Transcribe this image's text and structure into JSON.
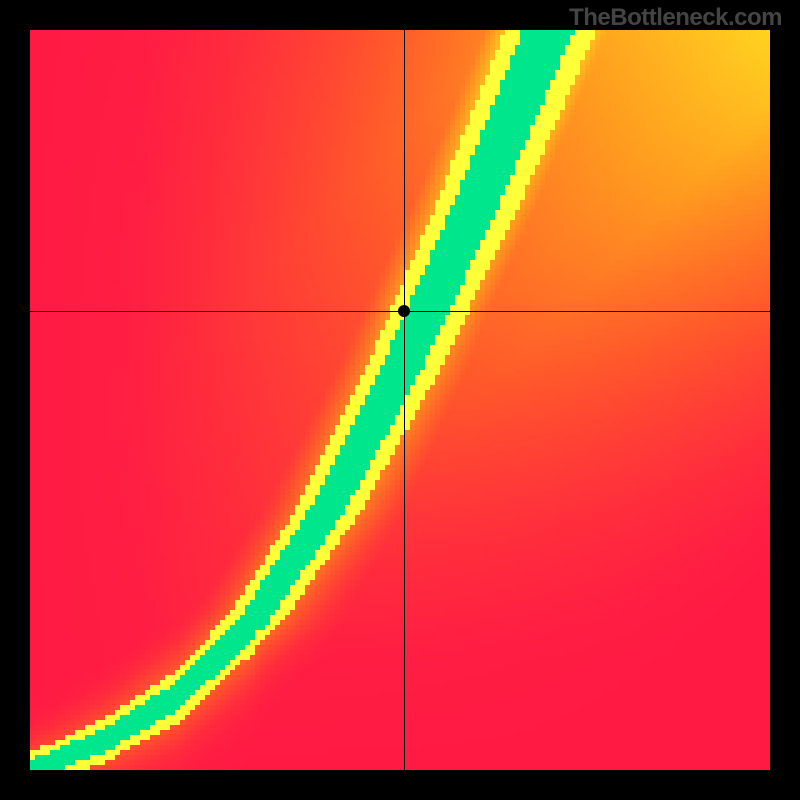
{
  "watermark": "TheBottleneck.com",
  "chart_data": {
    "type": "heatmap",
    "title": "",
    "xlabel": "",
    "ylabel": "",
    "xlim": [
      0,
      1
    ],
    "ylim": [
      0,
      1
    ],
    "grid": false,
    "marker": {
      "x": 0.505,
      "y": 0.62
    },
    "crosshair": {
      "x": 0.505,
      "y": 0.62
    },
    "ridge_curve": [
      {
        "x": 0.0,
        "y": 0.0
      },
      {
        "x": 0.1,
        "y": 0.04
      },
      {
        "x": 0.2,
        "y": 0.1
      },
      {
        "x": 0.3,
        "y": 0.2
      },
      {
        "x": 0.4,
        "y": 0.35
      },
      {
        "x": 0.5,
        "y": 0.54
      },
      {
        "x": 0.6,
        "y": 0.76
      },
      {
        "x": 0.7,
        "y": 1.0
      }
    ],
    "value_scale": {
      "min": 0.0,
      "max": 1.0,
      "note": "0 = worst (red), 1 = best (green) along ridge"
    },
    "color_stops": [
      {
        "value": 0.0,
        "color": "#ff1a44"
      },
      {
        "value": 0.25,
        "color": "#ff5a2a"
      },
      {
        "value": 0.5,
        "color": "#ff9a1f"
      },
      {
        "value": 0.75,
        "color": "#ffd61f"
      },
      {
        "value": 0.88,
        "color": "#ffff3a"
      },
      {
        "value": 1.0,
        "color": "#00e68c"
      }
    ],
    "resolution": 148
  }
}
